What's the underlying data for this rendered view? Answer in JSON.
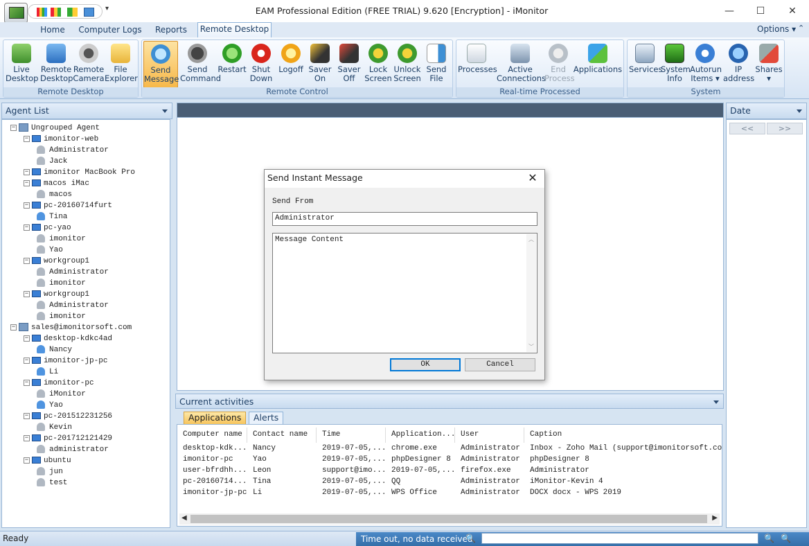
{
  "window": {
    "title": "EAM Professional Edition (FREE TRIAL) 9.620 [Encryption] - iMonitor",
    "min": "—",
    "max": "☐",
    "close": "✕"
  },
  "menu_tabs": [
    "Home",
    "Computer Logs",
    "Reports",
    "Remote Desktop"
  ],
  "options_label": "Options",
  "ribbon": {
    "groups": [
      {
        "label": "Remote Desktop"
      },
      {
        "label": "Remote Control"
      },
      {
        "label": "Real-time Processed"
      },
      {
        "label": "System"
      }
    ],
    "buttons": {
      "live_desktop": "Live\nDesktop",
      "remote_desktop": "Remote\nDesktop",
      "remote_camera": "Remote\nCamera",
      "file_explorer": "File\nExplorer",
      "send_message": "Send\nMessage",
      "send_command": "Send\nCommand",
      "restart": "Restart",
      "shut_down": "Shut\nDown",
      "logoff": "Logoff",
      "saver_on": "Saver\nOn",
      "saver_off": "Saver\nOff",
      "lock_screen": "Lock\nScreen",
      "unlock_screen": "Unlock\nScreen",
      "send_file": "Send\nFile",
      "processes": "Processes",
      "active_connections": "Active\nConnections",
      "end_process": "End\nProcess",
      "applications": "Applications",
      "services": "Services",
      "system_info": "System\nInfo",
      "autorun_items": "Autorun\nItems ▾",
      "ip_address": "IP\naddress",
      "shares": "Shares\n▾"
    }
  },
  "agent_list": {
    "title": "Agent List",
    "nodes": [
      {
        "text": "Ungrouped Agent",
        "kind": "group"
      },
      {
        "text": "imonitor-web",
        "kind": "pc"
      },
      {
        "text": "Administrator",
        "kind": "user"
      },
      {
        "text": "Jack",
        "kind": "user"
      },
      {
        "text": "imonitor  MacBook Pro",
        "kind": "pc"
      },
      {
        "text": "macos  iMac",
        "kind": "pc"
      },
      {
        "text": "macos",
        "kind": "user"
      },
      {
        "text": "pc-20160714furt",
        "kind": "pc"
      },
      {
        "text": "Tina",
        "kind": "user_on"
      },
      {
        "text": "pc-yao",
        "kind": "pc"
      },
      {
        "text": "imonitor",
        "kind": "user"
      },
      {
        "text": "Yao",
        "kind": "user"
      },
      {
        "text": "workgroup1",
        "kind": "pc"
      },
      {
        "text": "Administrator",
        "kind": "user"
      },
      {
        "text": "imonitor",
        "kind": "user"
      },
      {
        "text": "workgroup1",
        "kind": "pc"
      },
      {
        "text": "Administrator",
        "kind": "user"
      },
      {
        "text": "imonitor",
        "kind": "user"
      },
      {
        "text": "sales@imonitorsoft.com",
        "kind": "group"
      },
      {
        "text": "desktop-kdkc4ad",
        "kind": "pc"
      },
      {
        "text": "Nancy",
        "kind": "user_on"
      },
      {
        "text": "imonitor-jp-pc",
        "kind": "pc"
      },
      {
        "text": "Li",
        "kind": "user_on"
      },
      {
        "text": "imonitor-pc",
        "kind": "pc"
      },
      {
        "text": "iMonitor",
        "kind": "user"
      },
      {
        "text": "Yao",
        "kind": "user_on"
      },
      {
        "text": "pc-201512231256",
        "kind": "pc"
      },
      {
        "text": "Kevin",
        "kind": "user"
      },
      {
        "text": "pc-201712121429",
        "kind": "pc"
      },
      {
        "text": "administrator",
        "kind": "user"
      },
      {
        "text": "ubuntu",
        "kind": "pc"
      },
      {
        "text": "jun",
        "kind": "user"
      },
      {
        "text": "test",
        "kind": "user"
      }
    ]
  },
  "dialog": {
    "title": "Send Instant Message",
    "close": "✕",
    "send_from_label": "Send From",
    "send_from_value": "Administrator",
    "content_placeholder": "Message Content",
    "ok": "OK",
    "cancel": "Cancel"
  },
  "activities": {
    "title": "Current activities",
    "tabs": [
      "Applications",
      "Alerts"
    ],
    "columns": [
      "Computer name",
      "Contact name",
      "Time",
      "Application...",
      "User",
      "Caption"
    ],
    "rows": [
      [
        "desktop-kdk...",
        "Nancy",
        "2019-07-05,...",
        "chrome.exe",
        "Administrator",
        "Inbox - Zoho Mail (support@imonitorsoft.com) ..."
      ],
      [
        "imonitor-pc",
        "Yao",
        "2019-07-05,...",
        "phpDesigner 8",
        "Administrator",
        "phpDesigner 8"
      ],
      [
        "user-bfrdhh...",
        "Leon",
        "support@imo...",
        "2019-07-05,...",
        "firefox.exe",
        "Administrator"
      ],
      [
        "pc-20160714...",
        "Tina",
        "2019-07-05,...",
        "QQ",
        "Administrator",
        "iMonitor-Kevin 4"
      ],
      [
        "imonitor-jp-pc",
        "Li",
        "2019-07-05,...",
        "WPS Office",
        "Administrator",
        "DOCX  docx - WPS 2019"
      ]
    ]
  },
  "date_panel": {
    "title": "Date",
    "prev": "<<",
    "next": ">>"
  },
  "status": {
    "left": "Ready",
    "middle": "Time out, no data received"
  }
}
